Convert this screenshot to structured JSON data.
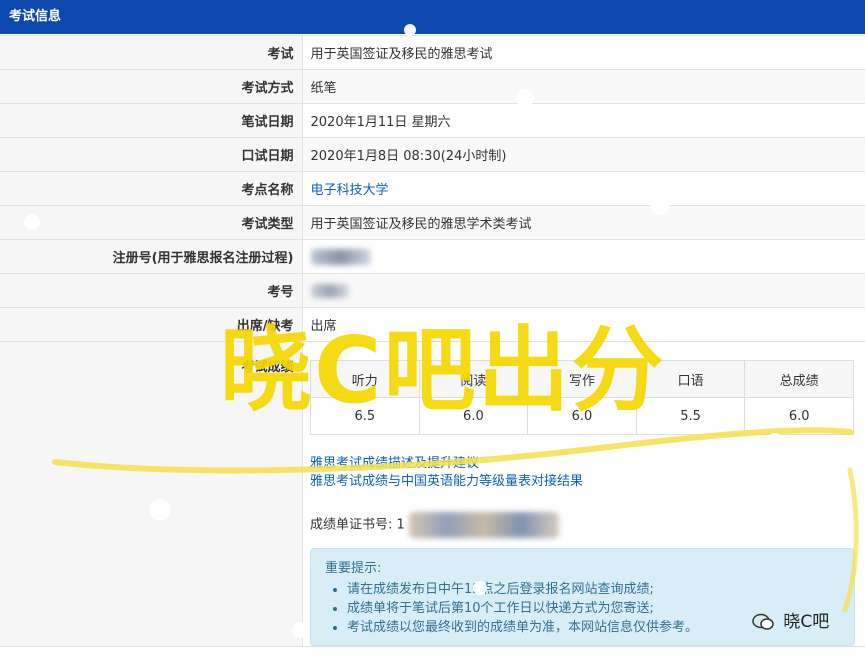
{
  "header": {
    "title": "考试信息"
  },
  "rows": [
    {
      "label": "考试",
      "value": "用于英国签证及移民的雅思考试"
    },
    {
      "label": "考试方式",
      "value": "纸笔"
    },
    {
      "label": "笔试日期",
      "value": "2020年1月11日 星期六"
    },
    {
      "label": "口试日期",
      "value": "2020年1月8日 08:30(24小时制)"
    },
    {
      "label": "考点名称",
      "value": "电子科技大学"
    },
    {
      "label": "考试类型",
      "value": "用于英国签证及移民的雅思学术类考试"
    },
    {
      "label": "注册号(用于雅思报名注册过程)",
      "value": ""
    },
    {
      "label": "考号",
      "value": ""
    },
    {
      "label": "出席/缺考",
      "value": "出席"
    }
  ],
  "scores": {
    "label": "考试成绩",
    "headers": [
      "听力",
      "阅读",
      "写作",
      "口语",
      "总成绩"
    ],
    "values": [
      "6.5",
      "6.0",
      "6.0",
      "5.5",
      "6.0"
    ]
  },
  "links": [
    "雅思考试成绩描述及提升建议",
    "雅思考试成绩与中国英语能力等级量表对接结果"
  ],
  "certificate": {
    "label": "成绩单证书号:",
    "prefix": "1"
  },
  "notice": {
    "title": "重要提示:",
    "items": [
      "请在成绩发布日中午12点之后登录报名网站查询成绩;",
      "成绩单将于笔试后第10个工作日以快递方式为您寄送;",
      "考试成绩以您最终收到的成绩单为准，本网站信息仅供参考。"
    ]
  },
  "overlay": {
    "watermark": "晓C吧出分",
    "badge": "晓C吧"
  },
  "colors": {
    "header_bg": "#0b49b0",
    "link": "#0b62b8",
    "notice_bg": "#d9edf7",
    "watermark": "#f5d800"
  }
}
